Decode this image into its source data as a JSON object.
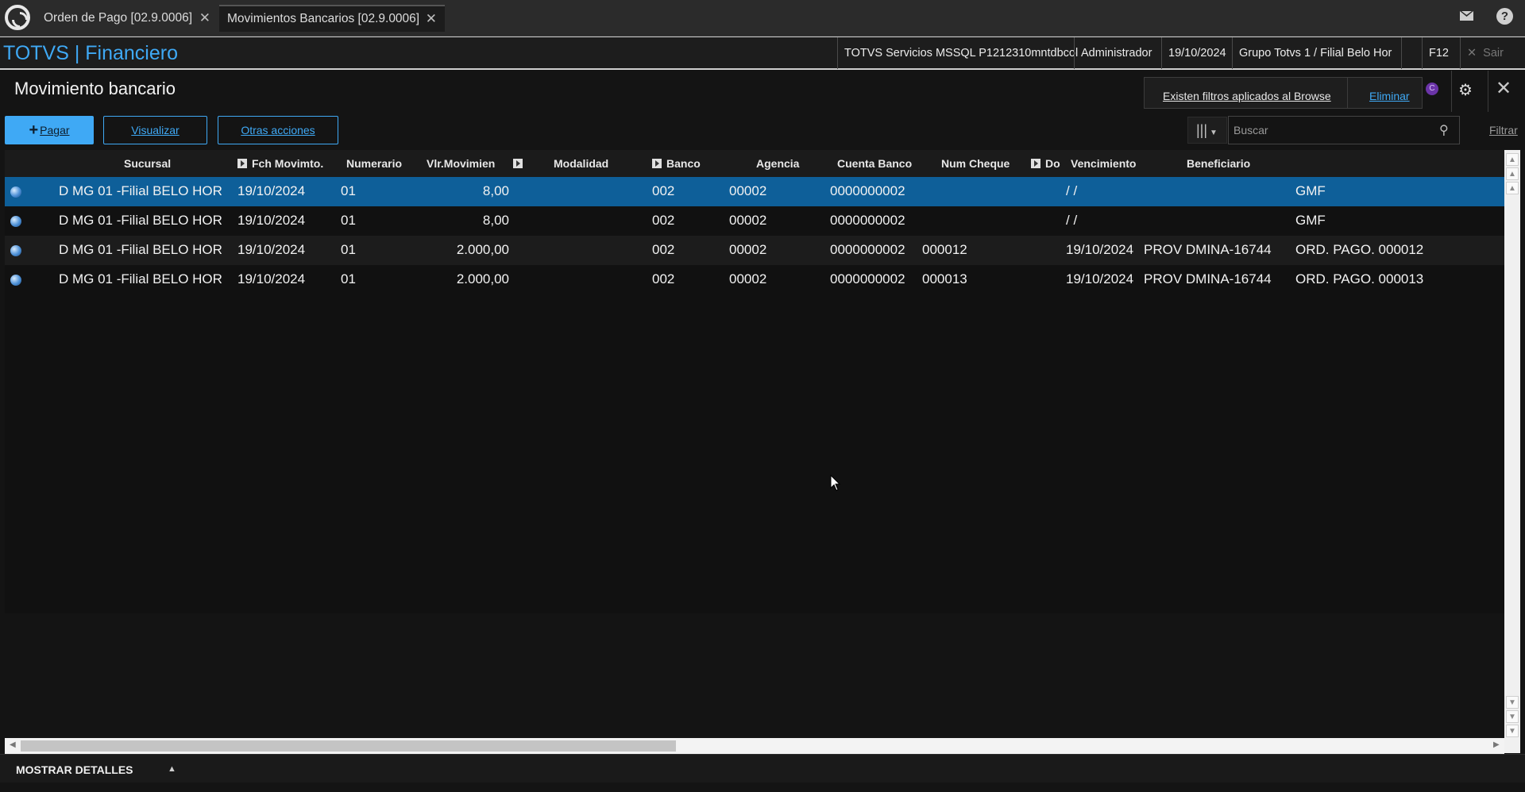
{
  "tabs": [
    {
      "label": "Orden de Pago [02.9.0006]",
      "close": "✕"
    },
    {
      "label": "Movimientos Bancarios [02.9.0006]",
      "close": "✕"
    }
  ],
  "header": {
    "brand": "TOTVS | Financiero",
    "server": "TOTVS Servicios MSSQL P1212310mntdbcol",
    "user": "Administrador",
    "date": "19/10/2024",
    "group": "Grupo Totvs 1 / Filial Belo Hor",
    "f12": "F12",
    "exit": "Sair"
  },
  "page": {
    "title": "Movimiento bancario",
    "filters_notice": "Existen filtros aplicados al Browse",
    "remove_filters": "Eliminar"
  },
  "toolbar": {
    "pay_label": "Pagar",
    "view_label": "Visualizar",
    "other_label": "Otras acciones",
    "search_placeholder": "Buscar",
    "filter_label": "Filtrar"
  },
  "grid": {
    "columns": {
      "sucursal": "Sucursal",
      "fecha": "Fch Movimto.",
      "numerario": "Numerario",
      "valor": "Vlr.Movimien",
      "modalidad": "Modalidad",
      "banco": "Banco",
      "agencia": "Agencia",
      "cuenta": "Cuenta Banco",
      "cheque": "Num Cheque",
      "doc": "Do",
      "venc": "Vencimiento",
      "benef": "Beneficiario"
    },
    "rows": [
      {
        "sucursal": "D MG 01 -Filial BELO HOR",
        "fecha": "19/10/2024",
        "numerario": "01",
        "valor": "8,00",
        "banco": "002",
        "agencia": "00002",
        "cuenta": "0000000002",
        "cheque": "",
        "venc": "/ /",
        "benef": "",
        "hist": "GMF"
      },
      {
        "sucursal": "D MG 01 -Filial BELO HOR",
        "fecha": "19/10/2024",
        "numerario": "01",
        "valor": "8,00",
        "banco": "002",
        "agencia": "00002",
        "cuenta": "0000000002",
        "cheque": "",
        "venc": "/ /",
        "benef": "",
        "hist": "GMF"
      },
      {
        "sucursal": "D MG 01 -Filial BELO HOR",
        "fecha": "19/10/2024",
        "numerario": "01",
        "valor": "2.000,00",
        "banco": "002",
        "agencia": "00002",
        "cuenta": "0000000002",
        "cheque": "000012",
        "venc": "19/10/2024",
        "benef": "PROV DMINA-16744",
        "hist": "ORD. PAGO. 000012"
      },
      {
        "sucursal": "D MG 01 -Filial BELO HOR",
        "fecha": "19/10/2024",
        "numerario": "01",
        "valor": "2.000,00",
        "banco": "002",
        "agencia": "00002",
        "cuenta": "0000000002",
        "cheque": "000013",
        "venc": "19/10/2024",
        "benef": "PROV DMINA-16744",
        "hist": "ORD. PAGO. 000013"
      }
    ]
  },
  "footer": {
    "details_label": "MOSTRAR DETALLES"
  },
  "colors": {
    "accent": "#3fa9f5",
    "selected_row": "#0e5f99",
    "background": "#141414"
  }
}
